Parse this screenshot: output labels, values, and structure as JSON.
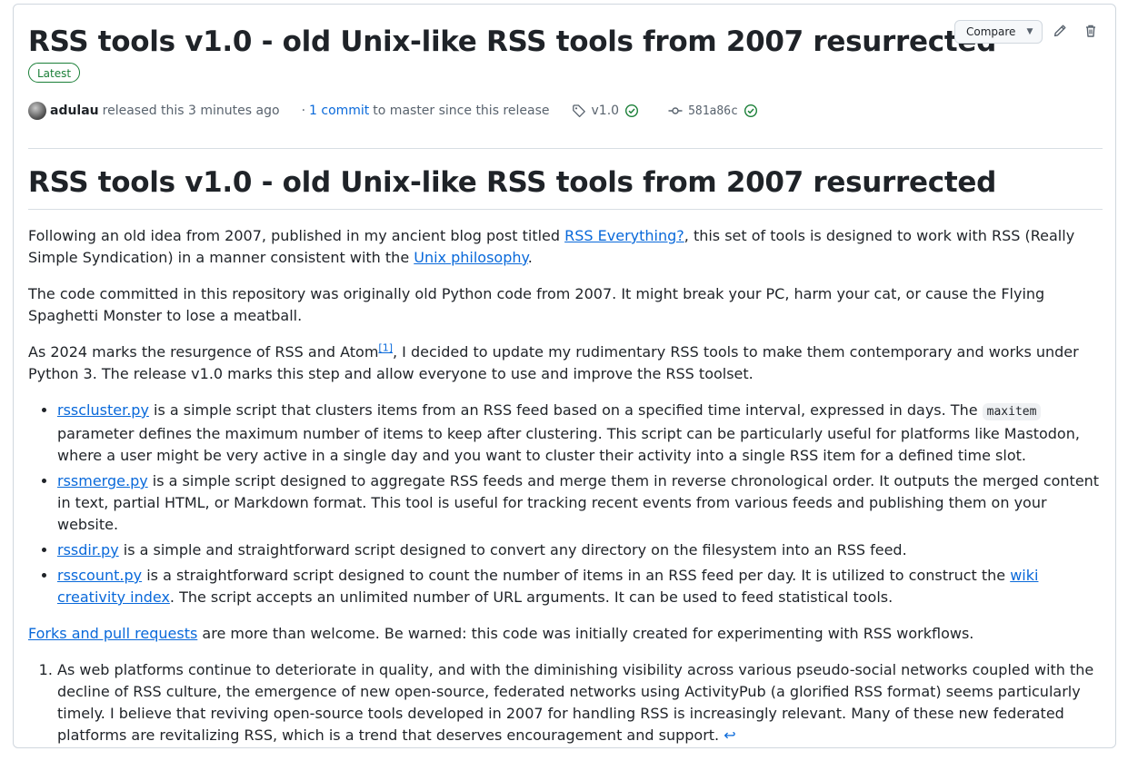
{
  "release": {
    "title": "RSS tools v1.0 - old Unix-like RSS tools from 2007 resurrected",
    "badge": "Latest",
    "compare_label": "Compare",
    "author": "adulau",
    "released_text": "released this 3 minutes ago",
    "separator": "·",
    "commits_link": "1 commit",
    "commits_suffix": "to master since this release",
    "tag": "v1.0",
    "commit_sha": "581a86c",
    "icons": {
      "edit": "pencil-icon",
      "delete": "trash-icon",
      "tag": "tag-icon",
      "commit": "git-commit-icon",
      "verified": "check-circle-icon",
      "caret": "chevron-down-icon"
    },
    "colors": {
      "link": "#0969da",
      "success": "#1a7f37",
      "muted": "#59636e"
    }
  },
  "body": {
    "heading": "RSS tools v1.0 - old Unix-like RSS tools from 2007 resurrected",
    "p1": {
      "a": "Following an old idea from 2007, published in my ancient blog post titled",
      "link1": "RSS Everything?",
      "b": ", this set of tools is designed to work with RSS (Really Simple Syndication) in a manner consistent with the",
      "link2": "Unix philosophy",
      "c": "."
    },
    "p2": "The code committed in this repository was originally old Python code from 2007. It might break your PC, harm your cat, or cause the Flying Spaghetti Monster to lose a meatball.",
    "p3": {
      "a": "As 2024 marks the resurgence of RSS and Atom",
      "footref": "[1]",
      "b": ", I decided to update my rudimentary RSS tools to make them contemporary and works under Python 3. The release v1.0 marks this step and allow everyone to use and improve the RSS toolset."
    },
    "tools": [
      {
        "name": "rsscluster.py",
        "a": "is a simple script that clusters items from an RSS feed based on a specified time interval, expressed in days. The",
        "code": "maxitem",
        "b": "parameter defines the maximum number of items to keep after clustering. This script can be particularly useful for platforms like Mastodon, where a user might be very active in a single day and you want to cluster their activity into a single RSS item for a defined time slot."
      },
      {
        "name": "rssmerge.py",
        "a": "is a simple script designed to aggregate RSS feeds and merge them in reverse chronological order. It outputs the merged content in text, partial HTML, or Markdown format. This tool is useful for tracking recent events from various feeds and publishing them on your website."
      },
      {
        "name": "rssdir.py",
        "a": "is a simple and straightforward script designed to convert any directory on the filesystem into an RSS feed."
      },
      {
        "name": "rsscount.py",
        "a": "is a straightforward script designed to count the number of items in an RSS feed per day. It is utilized to construct the",
        "link": "wiki creativity index",
        "b": ". The script accepts an unlimited number of URL arguments. It can be used to feed statistical tools."
      }
    ],
    "p4": {
      "link": "Forks and pull requests",
      "a": "are more than welcome. Be warned: this code was initially created for experimenting with RSS workflows."
    },
    "footnote": {
      "text": "As web platforms continue to deteriorate in quality, and with the diminishing visibility across various pseudo-social networks coupled with the decline of RSS culture, the emergence of new open-source, federated networks using ActivityPub (a glorified RSS format) seems particularly timely. I believe that reviving open-source tools developed in 2007 for handling RSS is increasingly relevant. Many of these new federated platforms are revitalizing RSS, which is a trend that deserves encouragement and support.",
      "backref": "↩"
    }
  }
}
